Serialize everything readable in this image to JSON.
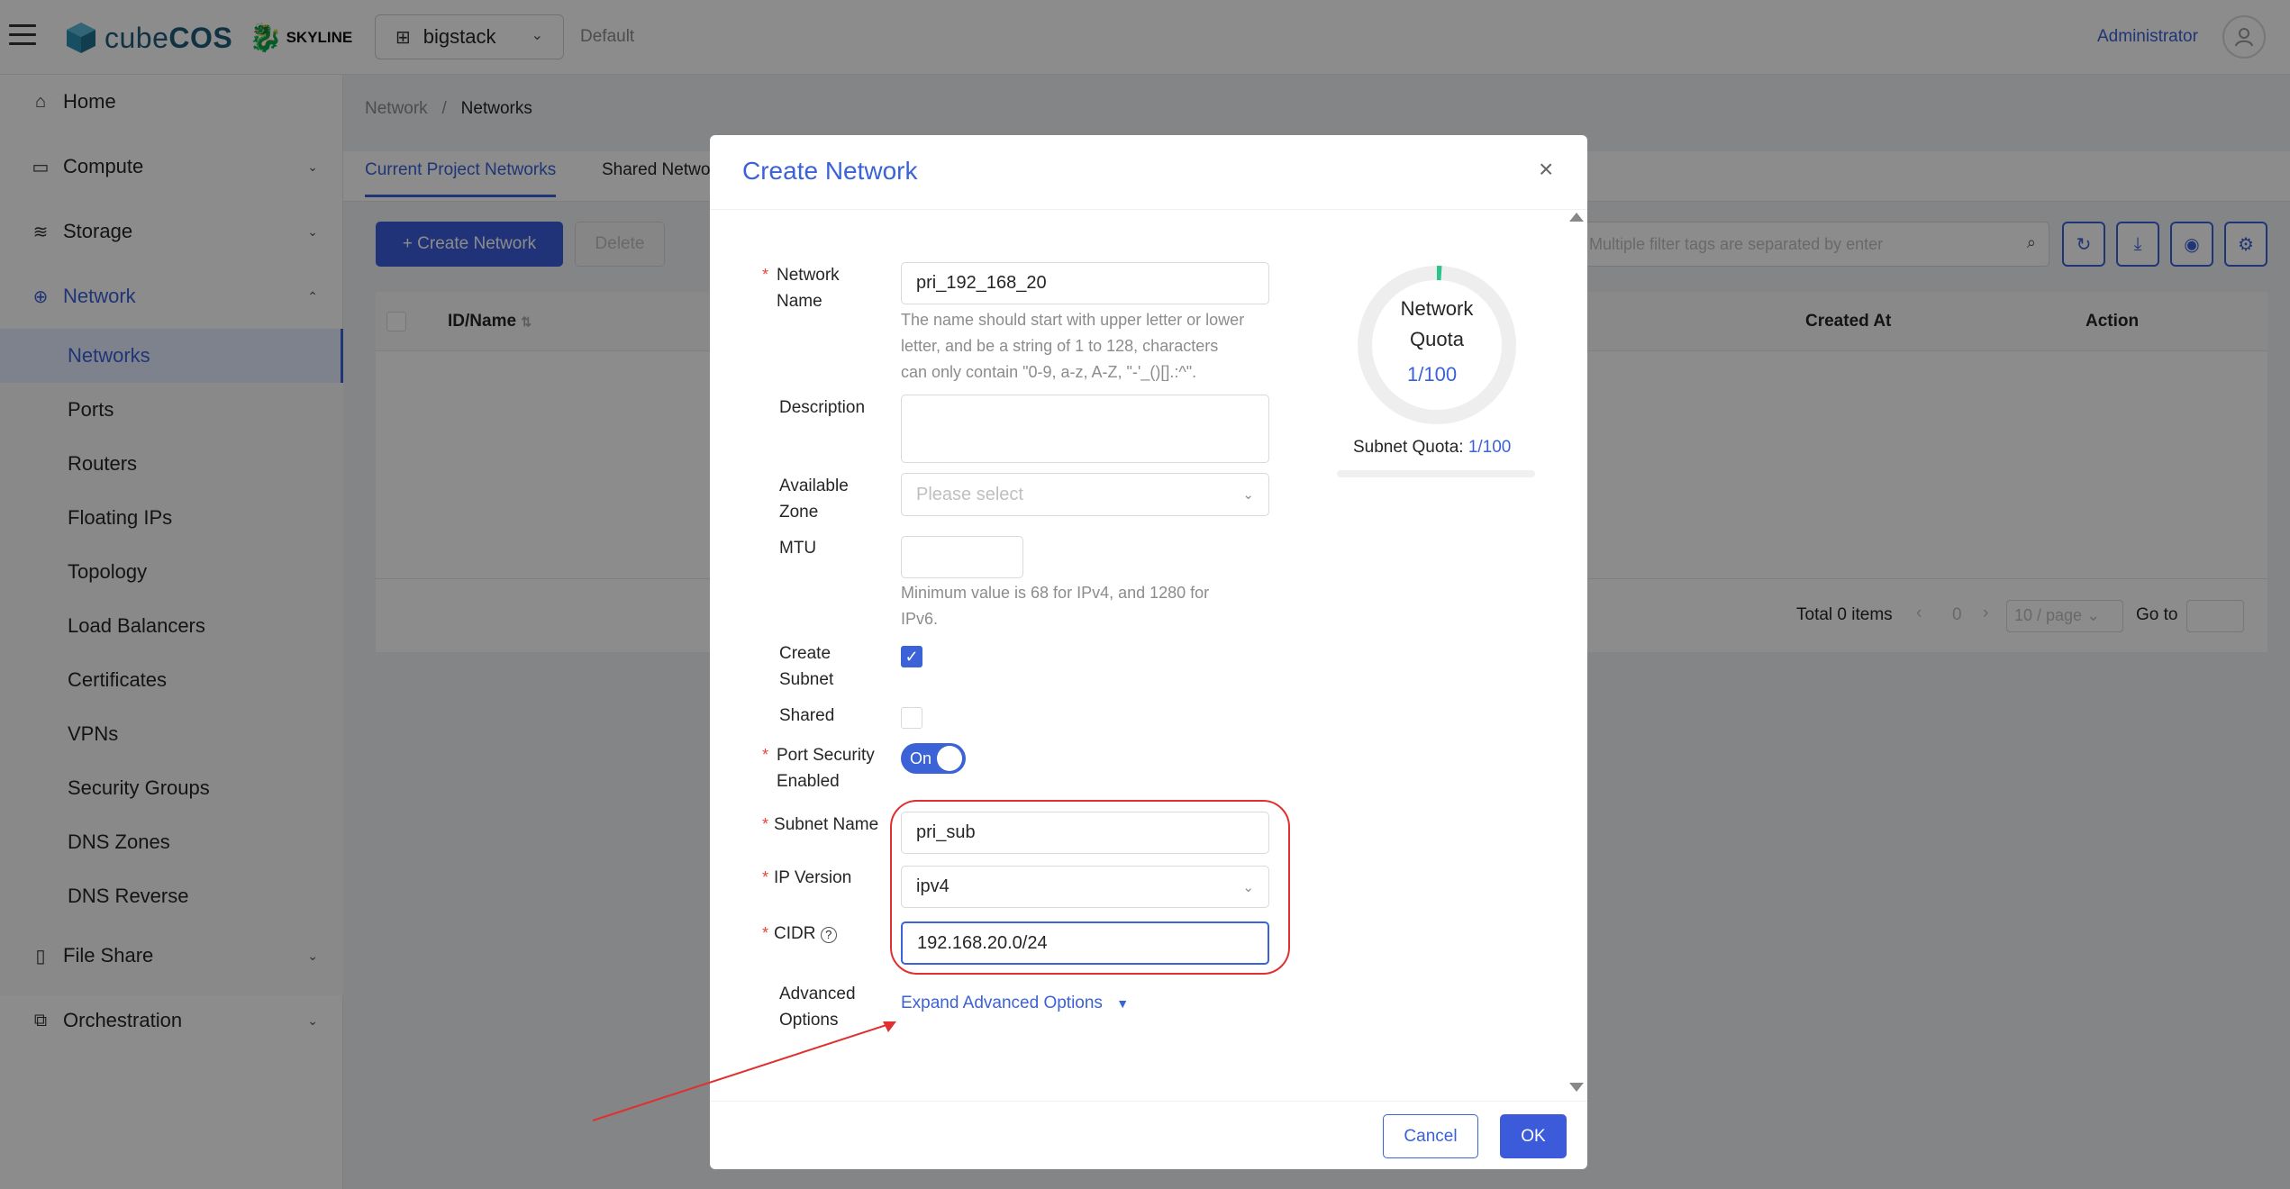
{
  "header": {
    "logo_text_light": "cube",
    "logo_text_bold": "COS",
    "partner": "SKYLINE",
    "project": "bigstack",
    "domain": "Default",
    "user": "Administrator"
  },
  "sidebar": {
    "items": [
      {
        "label": "Home",
        "icon": "home-icon"
      },
      {
        "label": "Compute",
        "icon": "monitor-icon"
      },
      {
        "label": "Storage",
        "icon": "database-icon"
      },
      {
        "label": "Network",
        "icon": "globe-icon"
      },
      {
        "label": "File Share",
        "icon": "file-icon"
      },
      {
        "label": "Orchestration",
        "icon": "puzzle-icon"
      }
    ],
    "network_sub": [
      "Networks",
      "Ports",
      "Routers",
      "Floating IPs",
      "Topology",
      "Load Balancers",
      "Certificates",
      "VPNs",
      "Security Groups",
      "DNS Zones",
      "DNS Reverse"
    ]
  },
  "breadcrumb": {
    "parent": "Network",
    "sep": "/",
    "current": "Networks"
  },
  "tabs": [
    "Current Project Networks",
    "Shared Netwo"
  ],
  "toolbar": {
    "create_label": "+ Create Network",
    "delete_label": "Delete",
    "search_placeholder": "Multiple filter tags are separated by enter"
  },
  "table": {
    "columns": [
      "ID/Name",
      "Created At",
      "Action"
    ],
    "total": "Total 0 items",
    "page": "0",
    "page_size": "10 / page",
    "goto": "Go to"
  },
  "modal": {
    "title": "Create Network",
    "fields": {
      "network_name_label_1": "Network",
      "network_name_label_2": "Name",
      "network_name_value": "pri_192_168_20",
      "network_name_help_1": "The name should start with upper letter or lower",
      "network_name_help_2": "letter, and be a string of 1 to 128, characters",
      "network_name_help_3": "can only contain \"0-9, a-z, A-Z, \"-'_()[].:^\".",
      "description_label": "Description",
      "zone_label_1": "Available",
      "zone_label_2": "Zone",
      "zone_placeholder": "Please select",
      "mtu_label": "MTU",
      "mtu_help_1": "Minimum value is 68 for IPv4, and 1280 for",
      "mtu_help_2": "IPv6.",
      "create_subnet_label_1": "Create",
      "create_subnet_label_2": "Subnet",
      "shared_label": "Shared",
      "port_security_label_1": "Port Security",
      "port_security_label_2": "Enabled",
      "port_security_value": "On",
      "subnet_name_label": "Subnet Name",
      "subnet_name_value": "pri_sub",
      "ip_version_label": "IP Version",
      "ip_version_value": "ipv4",
      "cidr_label": "CIDR",
      "cidr_value": "192.168.20.0/24",
      "advanced_label_1": "Advanced",
      "advanced_label_2": "Options",
      "advanced_link": "Expand Advanced Options"
    },
    "quota": {
      "title_1": "Network",
      "title_2": "Quota",
      "value": "1/100",
      "used": 1,
      "total": 100,
      "subnet_label": "Subnet Quota:",
      "subnet_value": "1/100"
    },
    "cancel_label": "Cancel",
    "ok_label": "OK"
  },
  "colors": {
    "accent": "#3b62d6",
    "annotation": "#e03030",
    "quota_used": "#2bc48a"
  }
}
